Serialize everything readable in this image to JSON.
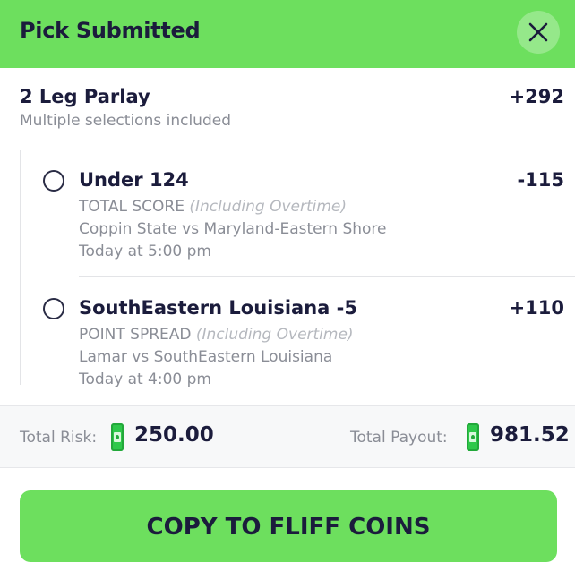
{
  "header": {
    "title": "Pick Submitted"
  },
  "parlay": {
    "title": "2 Leg Parlay",
    "subtitle": "Multiple selections included",
    "odds": "+292"
  },
  "legs": [
    {
      "selection": "Under 124",
      "odds": "-115",
      "market": "TOTAL SCORE",
      "qualifier": "(Including Overtime)",
      "event": "Coppin State vs Maryland-Eastern Shore",
      "time": "Today at 5:00 pm"
    },
    {
      "selection": "SouthEastern Louisiana -5",
      "odds": "+110",
      "market": "POINT SPREAD",
      "qualifier": "(Including Overtime)",
      "event": "Lamar vs SouthEastern Louisiana",
      "time": "Today at 4:00 pm"
    }
  ],
  "totals": {
    "risk_label": "Total Risk:",
    "risk_value": "250.00",
    "payout_label": "Total Payout:",
    "payout_value": "981.52"
  },
  "actions": {
    "copy_label": "COPY TO FLIFF COINS"
  },
  "icons": {
    "close": "close-icon",
    "coin": "fliff-coin-icon"
  },
  "colors": {
    "accent_green": "#6ddf5e",
    "text_dark": "#1b1c3c",
    "text_muted": "#8a8d96",
    "coin_green": "#2ec84a"
  }
}
